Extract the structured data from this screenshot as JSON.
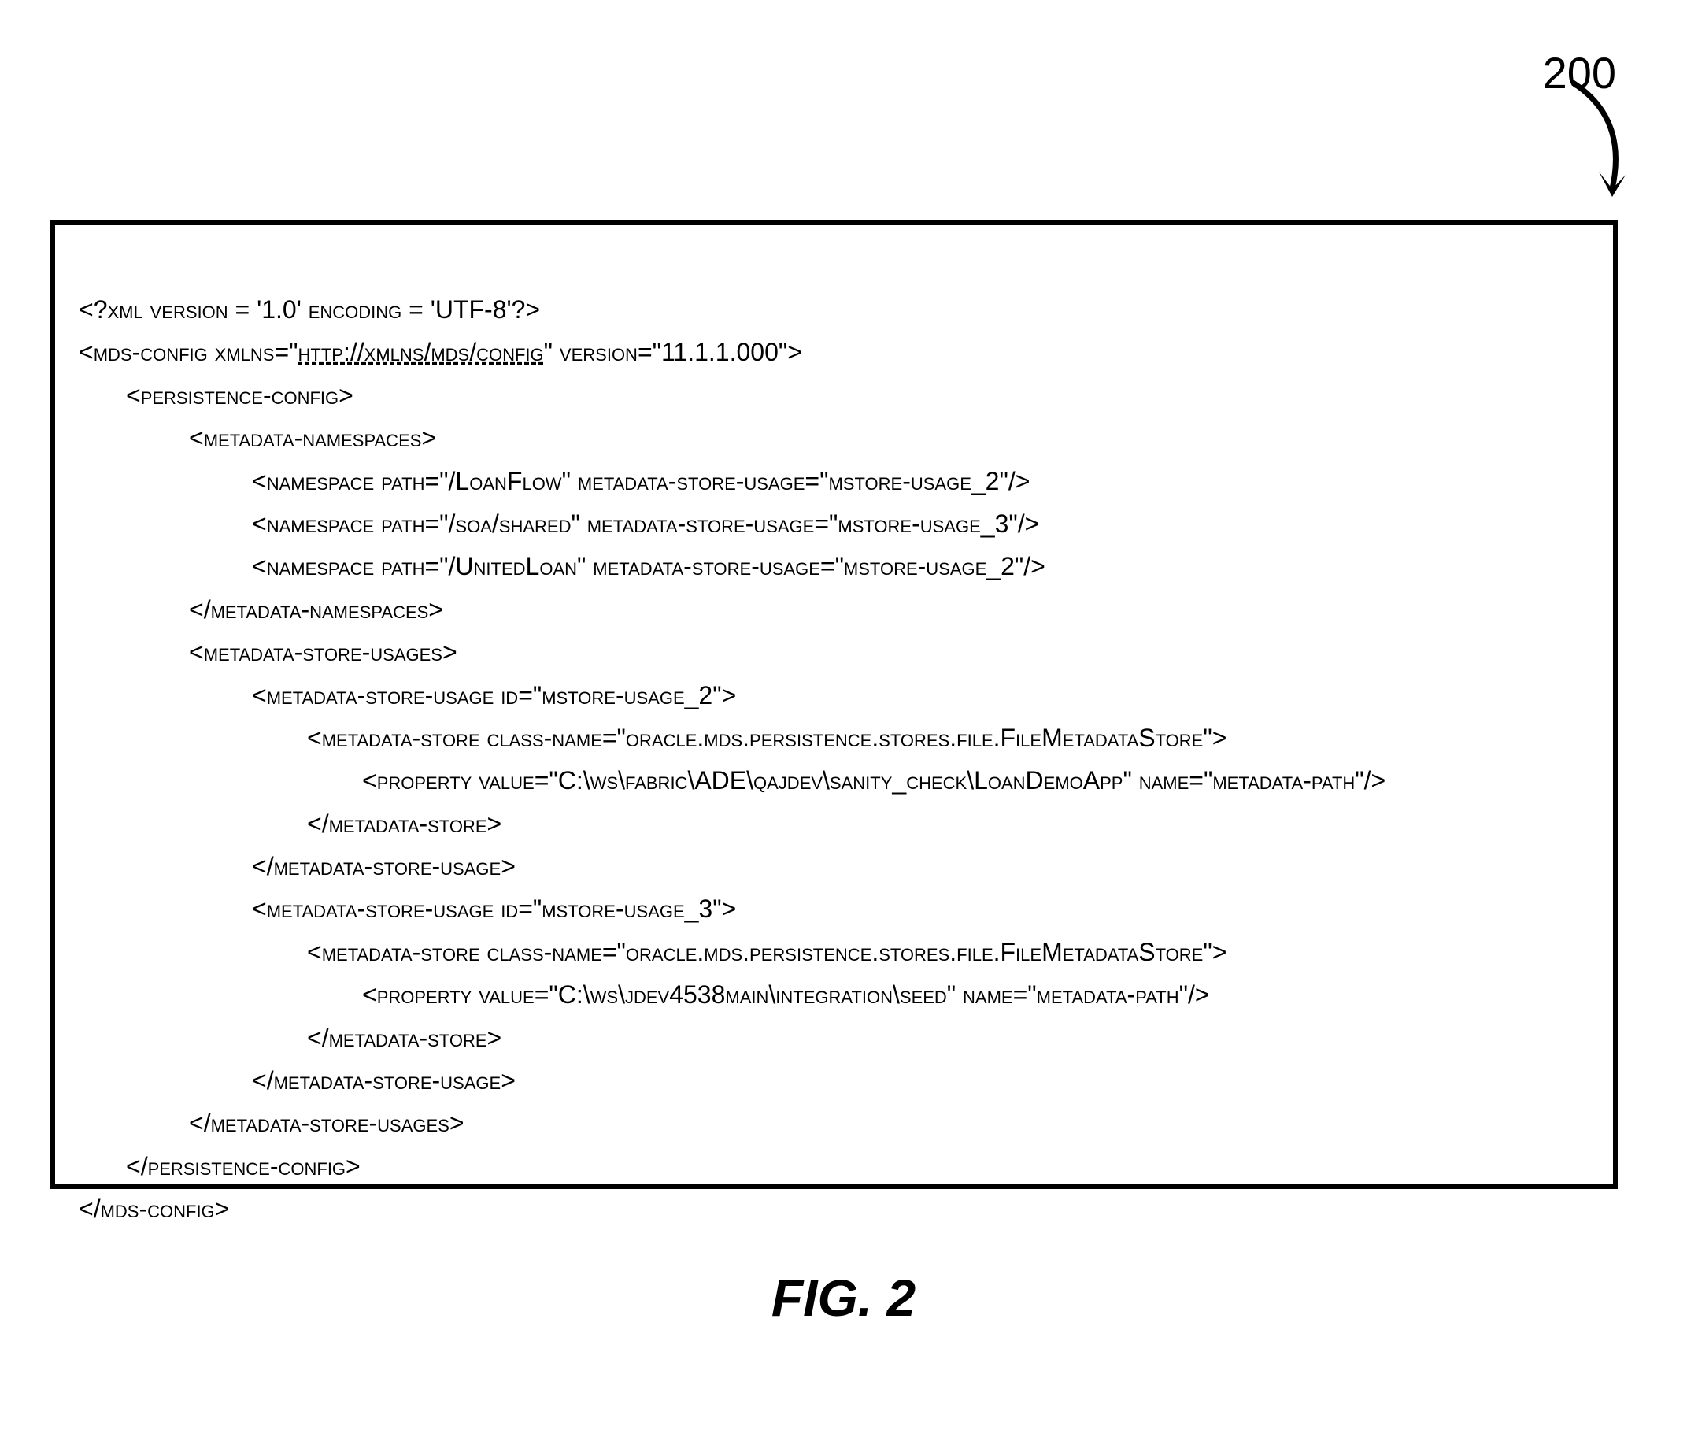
{
  "label_number": "200",
  "caption": "FIG. 2",
  "xml_lines": {
    "l1": "<?xml version = '1.0' encoding = 'UTF-8'?>",
    "l2_a": "<mds-config xmlns=\"",
    "l2_link": "http://xmlns/mds/config",
    "l2_b": "\" version=\"11.1.1.000\">",
    "l3": "<persistence-config>",
    "l4": "<metadata-namespaces>",
    "l5": "<namespace path=\"/LoanFlow\" metadata-store-usage=\"mstore-usage_2\"/>",
    "l6": "<namespace path=\"/soa/shared\" metadata-store-usage=\"mstore-usage_3\"/>",
    "l7": "<namespace path=\"/UnitedLoan\" metadata-store-usage=\"mstore-usage_2\"/>",
    "l8": "</metadata-namespaces>",
    "l9": "<metadata-store-usages>",
    "l10": "<metadata-store-usage id=\"mstore-usage_2\">",
    "l11": "<metadata-store class-name=\"oracle.mds.persistence.stores.file.FileMetadataStore\">",
    "l12": "<property value=\"C:\\ws\\fabric\\ADE\\qajdev\\sanity_check\\LoanDemoApp\" name=\"metadata-path\"/>",
    "l13": "</metadata-store>",
    "l14": "</metadata-store-usage>",
    "l15": "<metadata-store-usage id=\"mstore-usage_3\">",
    "l16": "<metadata-store class-name=\"oracle.mds.persistence.stores.file.FileMetadataStore\">",
    "l17": "<property value=\"C:\\ws\\jdev4538main\\integration\\seed\" name=\"metadata-path\"/>",
    "l18": "</metadata-store>",
    "l19": "</metadata-store-usage>",
    "l20": "</metadata-store-usages>",
    "l21": "</persistence-config>",
    "l22": "</mds-config>"
  }
}
